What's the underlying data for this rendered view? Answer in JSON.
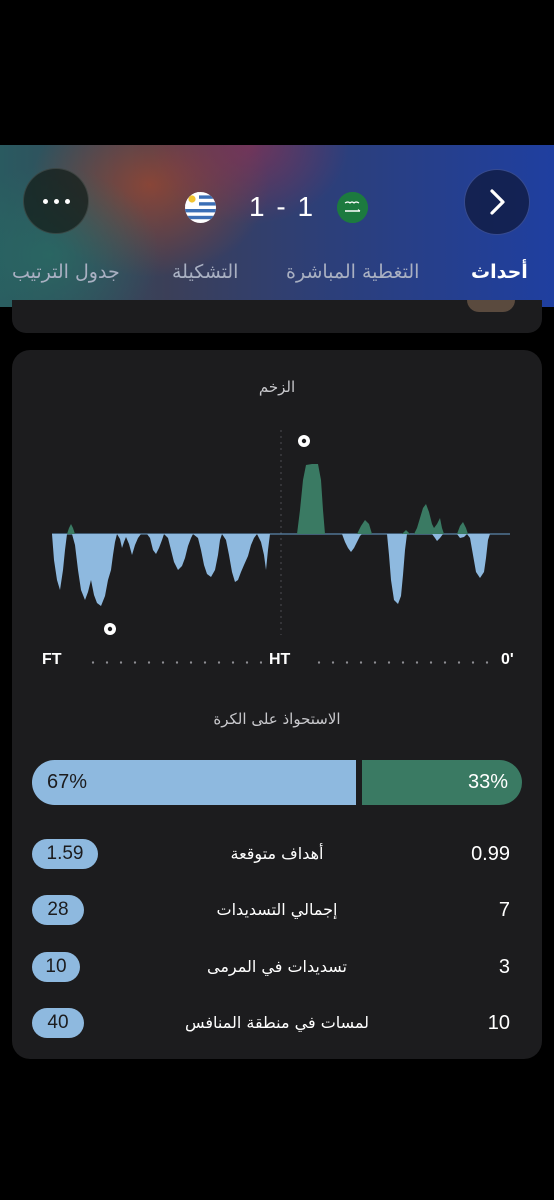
{
  "header": {
    "score": "1 - 1",
    "teams": {
      "left_flag": "uruguay-flag",
      "right_flag": "saudi-arabia-flag"
    },
    "more_icon": "more-dots-icon",
    "back_icon": "chevron-right-icon",
    "tabs": [
      {
        "label": "أحداث",
        "active": true
      },
      {
        "label": "التغطية المباشرة",
        "active": false
      },
      {
        "label": "التشكيلة",
        "active": false
      },
      {
        "label": "جدول الترتيب",
        "active": false
      }
    ]
  },
  "stats": {
    "momentum": {
      "title": "الزخم",
      "labels": {
        "end": "FT",
        "half": "HT",
        "start": "0'"
      }
    },
    "possession": {
      "title": "الاستحواذ على الكرة",
      "away": "67%",
      "home": "33%",
      "away_value": 0.67,
      "home_value": 0.33
    },
    "rows": [
      {
        "name": "أهداف متوقعة",
        "away": "1.59",
        "home": "0.99"
      },
      {
        "name": "إجمالي التسديدات",
        "away": "28",
        "home": "7"
      },
      {
        "name": "تسديدات في المرمى",
        "away": "10",
        "home": "3"
      },
      {
        "name": "لمسات في منطقة المنافس",
        "away": "40",
        "home": "10"
      }
    ],
    "colors": {
      "away": "#8eb9df",
      "home": "#3a7a63",
      "card": "#1c1c1e"
    }
  }
}
